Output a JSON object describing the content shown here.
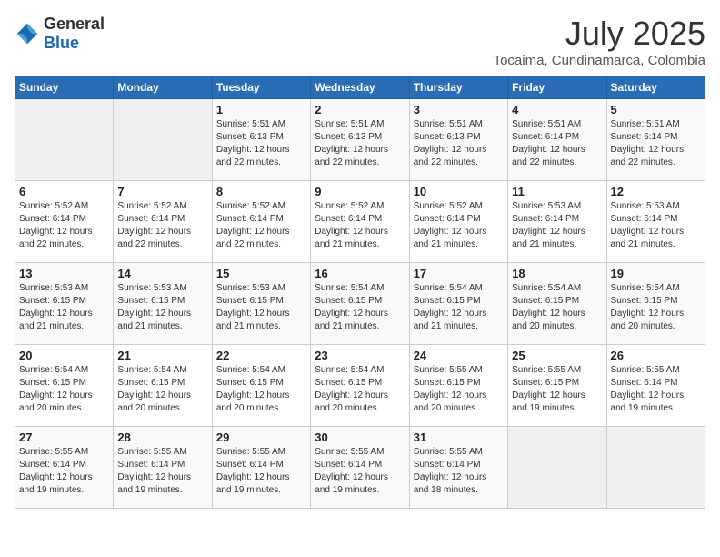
{
  "header": {
    "logo_general": "General",
    "logo_blue": "Blue",
    "month": "July 2025",
    "location": "Tocaima, Cundinamarca, Colombia"
  },
  "days_of_week": [
    "Sunday",
    "Monday",
    "Tuesday",
    "Wednesday",
    "Thursday",
    "Friday",
    "Saturday"
  ],
  "weeks": [
    [
      {
        "day": "",
        "sunrise": "",
        "sunset": "",
        "daylight": ""
      },
      {
        "day": "",
        "sunrise": "",
        "sunset": "",
        "daylight": ""
      },
      {
        "day": "1",
        "sunrise": "Sunrise: 5:51 AM",
        "sunset": "Sunset: 6:13 PM",
        "daylight": "Daylight: 12 hours and 22 minutes."
      },
      {
        "day": "2",
        "sunrise": "Sunrise: 5:51 AM",
        "sunset": "Sunset: 6:13 PM",
        "daylight": "Daylight: 12 hours and 22 minutes."
      },
      {
        "day": "3",
        "sunrise": "Sunrise: 5:51 AM",
        "sunset": "Sunset: 6:13 PM",
        "daylight": "Daylight: 12 hours and 22 minutes."
      },
      {
        "day": "4",
        "sunrise": "Sunrise: 5:51 AM",
        "sunset": "Sunset: 6:14 PM",
        "daylight": "Daylight: 12 hours and 22 minutes."
      },
      {
        "day": "5",
        "sunrise": "Sunrise: 5:51 AM",
        "sunset": "Sunset: 6:14 PM",
        "daylight": "Daylight: 12 hours and 22 minutes."
      }
    ],
    [
      {
        "day": "6",
        "sunrise": "Sunrise: 5:52 AM",
        "sunset": "Sunset: 6:14 PM",
        "daylight": "Daylight: 12 hours and 22 minutes."
      },
      {
        "day": "7",
        "sunrise": "Sunrise: 5:52 AM",
        "sunset": "Sunset: 6:14 PM",
        "daylight": "Daylight: 12 hours and 22 minutes."
      },
      {
        "day": "8",
        "sunrise": "Sunrise: 5:52 AM",
        "sunset": "Sunset: 6:14 PM",
        "daylight": "Daylight: 12 hours and 22 minutes."
      },
      {
        "day": "9",
        "sunrise": "Sunrise: 5:52 AM",
        "sunset": "Sunset: 6:14 PM",
        "daylight": "Daylight: 12 hours and 21 minutes."
      },
      {
        "day": "10",
        "sunrise": "Sunrise: 5:52 AM",
        "sunset": "Sunset: 6:14 PM",
        "daylight": "Daylight: 12 hours and 21 minutes."
      },
      {
        "day": "11",
        "sunrise": "Sunrise: 5:53 AM",
        "sunset": "Sunset: 6:14 PM",
        "daylight": "Daylight: 12 hours and 21 minutes."
      },
      {
        "day": "12",
        "sunrise": "Sunrise: 5:53 AM",
        "sunset": "Sunset: 6:14 PM",
        "daylight": "Daylight: 12 hours and 21 minutes."
      }
    ],
    [
      {
        "day": "13",
        "sunrise": "Sunrise: 5:53 AM",
        "sunset": "Sunset: 6:15 PM",
        "daylight": "Daylight: 12 hours and 21 minutes."
      },
      {
        "day": "14",
        "sunrise": "Sunrise: 5:53 AM",
        "sunset": "Sunset: 6:15 PM",
        "daylight": "Daylight: 12 hours and 21 minutes."
      },
      {
        "day": "15",
        "sunrise": "Sunrise: 5:53 AM",
        "sunset": "Sunset: 6:15 PM",
        "daylight": "Daylight: 12 hours and 21 minutes."
      },
      {
        "day": "16",
        "sunrise": "Sunrise: 5:54 AM",
        "sunset": "Sunset: 6:15 PM",
        "daylight": "Daylight: 12 hours and 21 minutes."
      },
      {
        "day": "17",
        "sunrise": "Sunrise: 5:54 AM",
        "sunset": "Sunset: 6:15 PM",
        "daylight": "Daylight: 12 hours and 21 minutes."
      },
      {
        "day": "18",
        "sunrise": "Sunrise: 5:54 AM",
        "sunset": "Sunset: 6:15 PM",
        "daylight": "Daylight: 12 hours and 20 minutes."
      },
      {
        "day": "19",
        "sunrise": "Sunrise: 5:54 AM",
        "sunset": "Sunset: 6:15 PM",
        "daylight": "Daylight: 12 hours and 20 minutes."
      }
    ],
    [
      {
        "day": "20",
        "sunrise": "Sunrise: 5:54 AM",
        "sunset": "Sunset: 6:15 PM",
        "daylight": "Daylight: 12 hours and 20 minutes."
      },
      {
        "day": "21",
        "sunrise": "Sunrise: 5:54 AM",
        "sunset": "Sunset: 6:15 PM",
        "daylight": "Daylight: 12 hours and 20 minutes."
      },
      {
        "day": "22",
        "sunrise": "Sunrise: 5:54 AM",
        "sunset": "Sunset: 6:15 PM",
        "daylight": "Daylight: 12 hours and 20 minutes."
      },
      {
        "day": "23",
        "sunrise": "Sunrise: 5:54 AM",
        "sunset": "Sunset: 6:15 PM",
        "daylight": "Daylight: 12 hours and 20 minutes."
      },
      {
        "day": "24",
        "sunrise": "Sunrise: 5:55 AM",
        "sunset": "Sunset: 6:15 PM",
        "daylight": "Daylight: 12 hours and 20 minutes."
      },
      {
        "day": "25",
        "sunrise": "Sunrise: 5:55 AM",
        "sunset": "Sunset: 6:15 PM",
        "daylight": "Daylight: 12 hours and 19 minutes."
      },
      {
        "day": "26",
        "sunrise": "Sunrise: 5:55 AM",
        "sunset": "Sunset: 6:14 PM",
        "daylight": "Daylight: 12 hours and 19 minutes."
      }
    ],
    [
      {
        "day": "27",
        "sunrise": "Sunrise: 5:55 AM",
        "sunset": "Sunset: 6:14 PM",
        "daylight": "Daylight: 12 hours and 19 minutes."
      },
      {
        "day": "28",
        "sunrise": "Sunrise: 5:55 AM",
        "sunset": "Sunset: 6:14 PM",
        "daylight": "Daylight: 12 hours and 19 minutes."
      },
      {
        "day": "29",
        "sunrise": "Sunrise: 5:55 AM",
        "sunset": "Sunset: 6:14 PM",
        "daylight": "Daylight: 12 hours and 19 minutes."
      },
      {
        "day": "30",
        "sunrise": "Sunrise: 5:55 AM",
        "sunset": "Sunset: 6:14 PM",
        "daylight": "Daylight: 12 hours and 19 minutes."
      },
      {
        "day": "31",
        "sunrise": "Sunrise: 5:55 AM",
        "sunset": "Sunset: 6:14 PM",
        "daylight": "Daylight: 12 hours and 18 minutes."
      },
      {
        "day": "",
        "sunrise": "",
        "sunset": "",
        "daylight": ""
      },
      {
        "day": "",
        "sunrise": "",
        "sunset": "",
        "daylight": ""
      }
    ]
  ]
}
